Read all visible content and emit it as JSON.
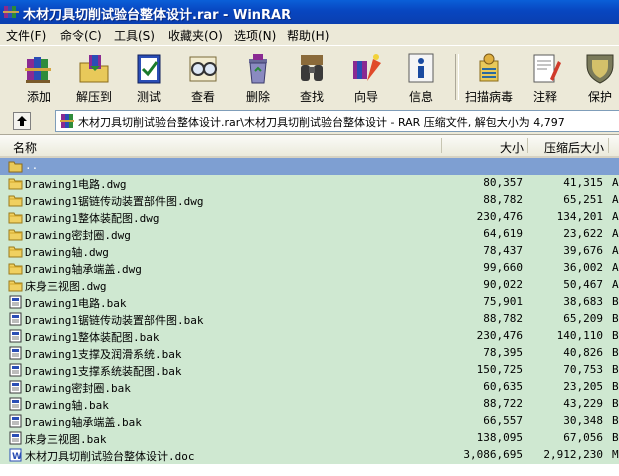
{
  "window": {
    "title": "木材刀具切削试验台整体设计.rar - WinRAR"
  },
  "menu": [
    {
      "label": "文件(F)"
    },
    {
      "label": "命令(C)"
    },
    {
      "label": "工具(S)"
    },
    {
      "label": "收藏夹(O)"
    },
    {
      "label": "选项(N)"
    },
    {
      "label": "帮助(H)"
    }
  ],
  "toolbar": [
    {
      "label": "添加",
      "icon": "add-books-icon"
    },
    {
      "label": "解压到",
      "icon": "extract-folder-icon"
    },
    {
      "label": "测试",
      "icon": "test-check-icon"
    },
    {
      "label": "查看",
      "icon": "view-glasses-icon"
    },
    {
      "label": "删除",
      "icon": "delete-recycle-icon"
    },
    {
      "label": "查找",
      "icon": "find-binoculars-icon"
    },
    {
      "label": "向导",
      "icon": "wizard-icon"
    },
    {
      "label": "信息",
      "icon": "info-icon"
    },
    {
      "label": "扫描病毒",
      "icon": "virus-scan-icon"
    },
    {
      "label": "注释",
      "icon": "comment-icon"
    },
    {
      "label": "保护",
      "icon": "protect-shield-icon"
    }
  ],
  "address": {
    "path": "木材刀具切削试验台整体设计.rar\\木材刀具切削试验台整体设计 - RAR 压缩文件, 解包大小为 4,797"
  },
  "columns": {
    "name": "名称",
    "size": "大小",
    "packed": "压缩后大小"
  },
  "colors": {
    "row_bg": "#cfe8d1",
    "selected_row": "#7e9fd2",
    "titlebar": "#0a46c0"
  },
  "files": [
    {
      "name": "..",
      "size": "",
      "packed": "",
      "extra": "",
      "type": "parent"
    },
    {
      "name": "Drawing1电路.dwg",
      "size": "80,357",
      "packed": "41,315",
      "extra": "A",
      "type": "dwg"
    },
    {
      "name": "Drawing1锯链传动装置部件图.dwg",
      "size": "88,782",
      "packed": "65,251",
      "extra": "A",
      "type": "dwg"
    },
    {
      "name": "Drawing1整体装配图.dwg",
      "size": "230,476",
      "packed": "134,201",
      "extra": "A",
      "type": "dwg"
    },
    {
      "name": "Drawing密封圈.dwg",
      "size": "64,619",
      "packed": "23,622",
      "extra": "A",
      "type": "dwg"
    },
    {
      "name": "Drawing轴.dwg",
      "size": "78,437",
      "packed": "39,676",
      "extra": "A",
      "type": "dwg"
    },
    {
      "name": "Drawing轴承端盖.dwg",
      "size": "99,660",
      "packed": "36,002",
      "extra": "A",
      "type": "dwg"
    },
    {
      "name": "床身三视图.dwg",
      "size": "90,022",
      "packed": "50,467",
      "extra": "A",
      "type": "dwg"
    },
    {
      "name": "Drawing1电路.bak",
      "size": "75,901",
      "packed": "38,683",
      "extra": "B",
      "type": "bak"
    },
    {
      "name": "Drawing1锯链传动装置部件图.bak",
      "size": "88,782",
      "packed": "65,209",
      "extra": "B",
      "type": "bak"
    },
    {
      "name": "Drawing1整体装配图.bak",
      "size": "230,476",
      "packed": "140,110",
      "extra": "B",
      "type": "bak"
    },
    {
      "name": "Drawing1支撑及润滑系统.bak",
      "size": "78,395",
      "packed": "40,826",
      "extra": "B",
      "type": "bak"
    },
    {
      "name": "Drawing1支撑系统装配图.bak",
      "size": "150,725",
      "packed": "70,753",
      "extra": "B",
      "type": "bak"
    },
    {
      "name": "Drawing密封圈.bak",
      "size": "60,635",
      "packed": "23,205",
      "extra": "B",
      "type": "bak"
    },
    {
      "name": "Drawing轴.bak",
      "size": "88,722",
      "packed": "43,229",
      "extra": "B",
      "type": "bak"
    },
    {
      "name": "Drawing轴承端盖.bak",
      "size": "66,557",
      "packed": "30,348",
      "extra": "B",
      "type": "bak"
    },
    {
      "name": "床身三视图.bak",
      "size": "138,095",
      "packed": "67,056",
      "extra": "B",
      "type": "bak"
    },
    {
      "name": "木材刀具切削试验台整体设计.doc",
      "size": "3,086,695",
      "packed": "2,912,230",
      "extra": "M",
      "type": "doc"
    }
  ]
}
